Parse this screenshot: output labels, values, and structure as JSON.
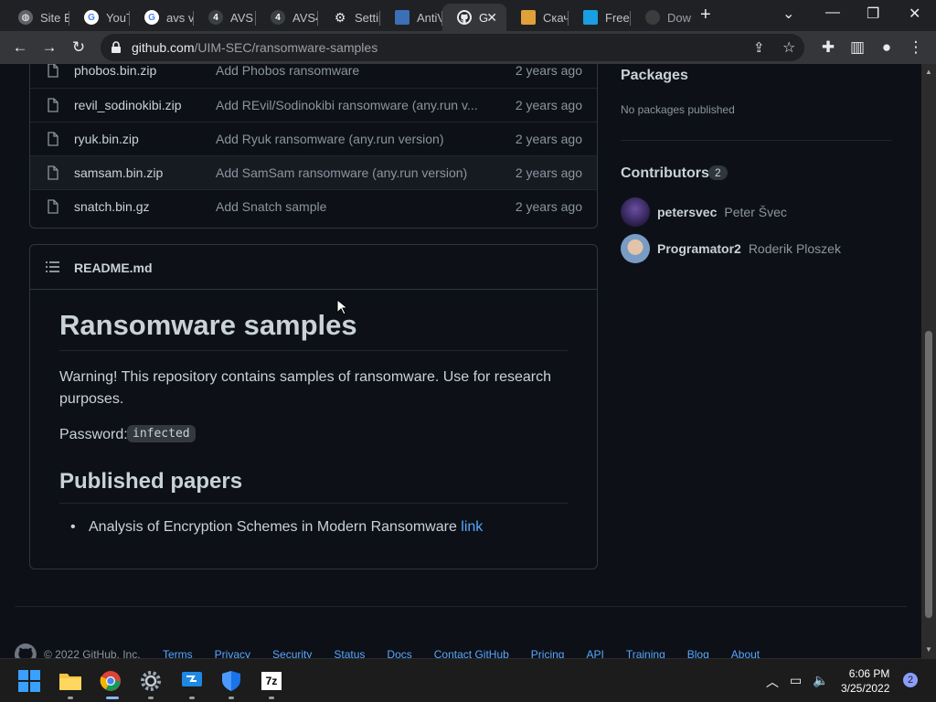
{
  "browser": {
    "tabs": [
      {
        "title": "Site E",
        "favicon": "globe-icon"
      },
      {
        "title": "YouTu",
        "favicon": "google-icon"
      },
      {
        "title": "avs v",
        "favicon": "google-icon"
      },
      {
        "title": "AVS \\",
        "favicon": "avs-4-icon"
      },
      {
        "title": "AVS4",
        "favicon": "avs-4-icon"
      },
      {
        "title": "Settin",
        "favicon": "gear-icon"
      },
      {
        "title": "AntiV",
        "favicon": "page-icon"
      },
      {
        "title": "G",
        "favicon": "github-icon",
        "active": true
      },
      {
        "title": "Скач",
        "favicon": "colorful-icon"
      },
      {
        "title": "Free",
        "favicon": "blue-square-icon"
      },
      {
        "title": "Dow",
        "favicon": "dark-shield-icon"
      }
    ],
    "url_host": "github.com",
    "url_path": "/UIM-SEC/ransomware-samples"
  },
  "files": [
    {
      "name": "phobos.bin.zip",
      "message": "Add Phobos ransomware",
      "age": "2 years ago"
    },
    {
      "name": "revil_sodinokibi.zip",
      "message": "Add REvil/Sodinokibi ransomware (any.run v...",
      "age": "2 years ago"
    },
    {
      "name": "ryuk.bin.zip",
      "message": "Add Ryuk ransomware (any.run version)",
      "age": "2 years ago"
    },
    {
      "name": "samsam.bin.zip",
      "message": "Add SamSam ransomware (any.run version)",
      "age": "2 years ago"
    },
    {
      "name": "snatch.bin.gz",
      "message": "Add Snatch sample",
      "age": "2 years ago"
    }
  ],
  "readme": {
    "filename": "README.md",
    "title": "Ransomware samples",
    "warning": "Warning! This repository contains samples of ransomware. Use for research purposes.",
    "password_label": "Password:",
    "password": "infected",
    "papers_heading": "Published papers",
    "paper_title": "Analysis of Encryption Schemes in Modern Ransomware",
    "paper_link": "link"
  },
  "sidebar": {
    "packages_title": "Packages",
    "packages_empty": "No packages published",
    "contributors_title": "Contributors",
    "contributors_count": "2",
    "contributors": [
      {
        "login": "petersvec",
        "name": "Peter Švec"
      },
      {
        "login": "Programator2",
        "name": "Roderik Ploszek"
      }
    ]
  },
  "footer": {
    "copyright": "© 2022 GitHub, Inc.",
    "links": [
      "Terms",
      "Privacy",
      "Security",
      "Status",
      "Docs",
      "Contact GitHub",
      "Pricing",
      "API",
      "Training",
      "Blog",
      "About"
    ]
  },
  "taskbar": {
    "apps": [
      "start-icon",
      "file-explorer-icon",
      "chrome-icon",
      "settings-icon",
      "remote-desktop-icon",
      "defender-icon",
      "7zip-icon"
    ],
    "time": "6:06 PM",
    "date": "3/25/2022",
    "notifications": "2"
  },
  "colors": {
    "page_bg": "#0d1117",
    "link": "#58a6ff",
    "muted": "#8b949e",
    "border": "#30363d"
  }
}
